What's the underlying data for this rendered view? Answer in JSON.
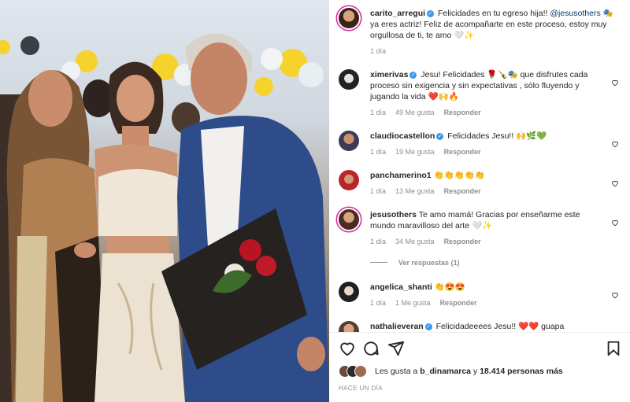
{
  "post": {
    "author": "carito_arregui",
    "caption_pre": "Felicidades en tu egreso hija!! ",
    "caption_mention": "@jesusothers",
    "caption_post": " 🎭 ya eres actriz! Feliz de acompañarte en este proceso, estoy muy orgullosa de ti, te amo 🤍✨",
    "time": "1 día"
  },
  "comments": [
    {
      "user": "ximerivas",
      "verified": true,
      "text": "Jesu! Felicidades 🌹🍾🎭 que disfrutes cada proceso sin exigencia y sin expectativas , sólo fluyendo y jugando la vida ❤️🙌🔥",
      "time": "1 día",
      "likes": "49 Me gusta",
      "reply": "Responder"
    },
    {
      "user": "claudiocastellon",
      "verified": true,
      "text": "Felicidades Jesu!! 🙌🌿💚",
      "time": "1 día",
      "likes": "19 Me gusta",
      "reply": "Responder"
    },
    {
      "user": "panchamerino1",
      "verified": false,
      "text": "👏👏👏👏👏",
      "time": "1 día",
      "likes": "13 Me gusta",
      "reply": "Responder"
    },
    {
      "user": "jesusothers",
      "verified": false,
      "text": "Te amo mamá! Gracias por enseñarme este mundo maravilloso del arte 🤍✨",
      "time": "1 día",
      "likes": "34 Me gusta",
      "reply": "Responder"
    },
    {
      "user": "angelica_shanti",
      "verified": false,
      "text": "👏😍😍",
      "time": "1 día",
      "likes": "1 Me gusta",
      "reply": "Responder"
    },
    {
      "user": "nathalieveran",
      "verified": true,
      "text": "Felicidadeeees Jesu!! ❤️❤️ guapa",
      "time": "",
      "likes": "",
      "reply": ""
    }
  ],
  "view_replies": "Ver respuestas (1)",
  "likes": {
    "prefix": "Les gusta a ",
    "user": "b_dinamarca",
    "middle": " y ",
    "count": "18.414 personas más"
  },
  "time_ago": "HACE UN DÍA",
  "icons": [
    "heart-icon",
    "comment-icon",
    "share-icon",
    "bookmark-icon",
    "verified-icon"
  ],
  "colors": {
    "mention": "#00376b",
    "verified": "#3897f0",
    "meta": "#8e8e8e",
    "story_ring": "#d6249f"
  }
}
